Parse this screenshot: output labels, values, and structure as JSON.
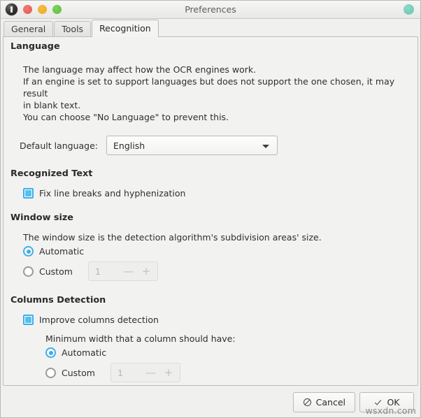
{
  "window": {
    "title": "Preferences",
    "app_icon": "app-icon",
    "controls": {
      "close": "close-button",
      "minimize": "minimize-button",
      "maximize": "maximize-button",
      "right_indicator": "status-indicator"
    }
  },
  "tabs": [
    {
      "label": "General",
      "active": false
    },
    {
      "label": "Tools",
      "active": false
    },
    {
      "label": "Recognition",
      "active": true
    }
  ],
  "sections": {
    "language": {
      "title": "Language",
      "paragraph_lines": [
        "The language may affect how the OCR engines work.",
        "If an engine is set to support languages but does not support the one chosen, it may result",
        "in blank text.",
        "You can choose \"No Language\" to prevent this."
      ],
      "default_language_label": "Default language:",
      "default_language_value": "English"
    },
    "recognized_text": {
      "title": "Recognized Text",
      "fix_line_breaks_label": "Fix line breaks and hyphenization",
      "fix_line_breaks_checked": "checked"
    },
    "window_size": {
      "title": "Window size",
      "description": "The window size is the detection algorithm's subdivision areas' size.",
      "automatic_label": "Automatic",
      "custom_label": "Custom",
      "selected": "Automatic",
      "custom_value": "1",
      "minus_label": "—",
      "plus_label": "+"
    },
    "columns_detection": {
      "title": "Columns Detection",
      "improve_label": "Improve columns detection",
      "improve_checked": "checked",
      "minimum_width_label": "Minimum width that a column should have:",
      "automatic_label": "Automatic",
      "custom_label": "Custom",
      "selected": "Automatic",
      "custom_value": "1",
      "minus_label": "—",
      "plus_label": "+"
    }
  },
  "buttons": {
    "cancel": "Cancel",
    "ok": "OK"
  },
  "watermark": "wsxdn.com",
  "colors": {
    "accent": "#3daee9",
    "checkbox_fill": "#54c0ef",
    "window_bg": "#f0f0ef",
    "panel_bg": "#f2f2f1",
    "close_dot": "#e3574d",
    "minimize_dot": "#edab1f",
    "maximize_dot": "#5ec13c",
    "indicator_dot": "#69c4b0"
  }
}
